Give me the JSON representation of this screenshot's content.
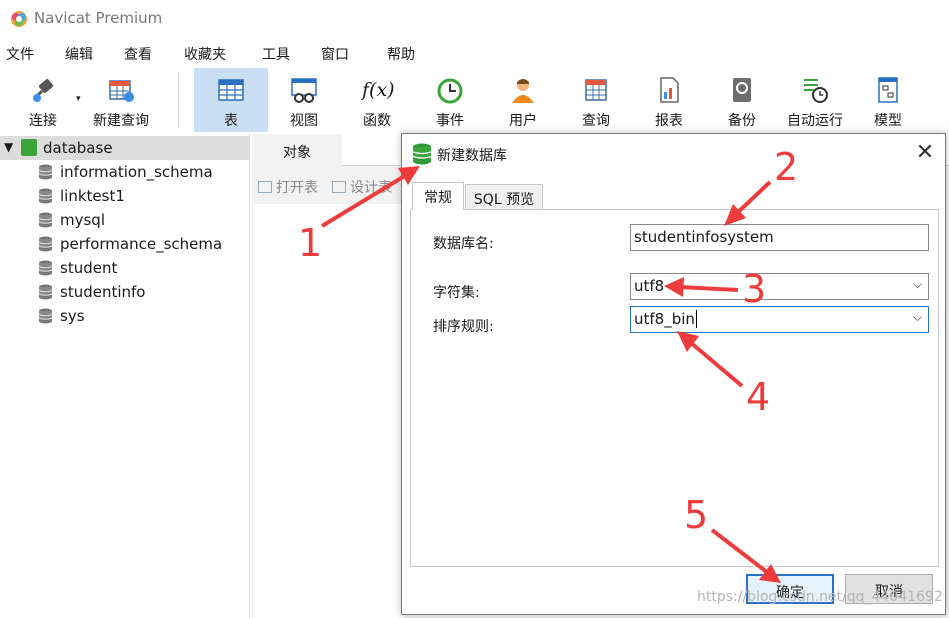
{
  "app": {
    "title": "Navicat Premium"
  },
  "menu": [
    "文件",
    "编辑",
    "查看",
    "收藏夹",
    "工具",
    "窗口",
    "帮助"
  ],
  "toolbar": {
    "items": [
      {
        "label": "连接",
        "icon": "plug-icon"
      },
      {
        "label": "新建查询",
        "icon": "new-query-icon"
      },
      {
        "label": "表",
        "icon": "table-icon",
        "active": true
      },
      {
        "label": "视图",
        "icon": "view-icon"
      },
      {
        "label": "函数",
        "icon": "function-icon",
        "glyph": "f(x)"
      },
      {
        "label": "事件",
        "icon": "clock-icon"
      },
      {
        "label": "用户",
        "icon": "user-icon"
      },
      {
        "label": "查询",
        "icon": "query-icon"
      },
      {
        "label": "报表",
        "icon": "report-icon"
      },
      {
        "label": "备份",
        "icon": "backup-icon"
      },
      {
        "label": "自动运行",
        "icon": "schedule-icon"
      },
      {
        "label": "模型",
        "icon": "model-icon"
      }
    ]
  },
  "sidebar": {
    "root": "database",
    "items": [
      "information_schema",
      "linktest1",
      "mysql",
      "performance_schema",
      "student",
      "studentinfo",
      "sys"
    ]
  },
  "objects": {
    "tab": "对象",
    "open_table": "打开表",
    "design_table": "设计表"
  },
  "dialog": {
    "title": "新建数据库",
    "tabs": [
      "常规",
      "SQL 预览"
    ],
    "fields": {
      "name_label": "数据库名:",
      "name_value": "studentinfosystem",
      "charset_label": "字符集:",
      "charset_value": "utf8",
      "collation_label": "排序规则:",
      "collation_value": "utf8_bin"
    },
    "ok": "确定",
    "cancel": "取消"
  },
  "annotations": [
    "1",
    "2",
    "3",
    "4",
    "5"
  ],
  "colors": {
    "arrow": "#ee3b3b",
    "accent": "#2b73c9",
    "active_tool": "#c9dff3"
  },
  "watermark": "https://blog.csdn.net/qq_44041692"
}
